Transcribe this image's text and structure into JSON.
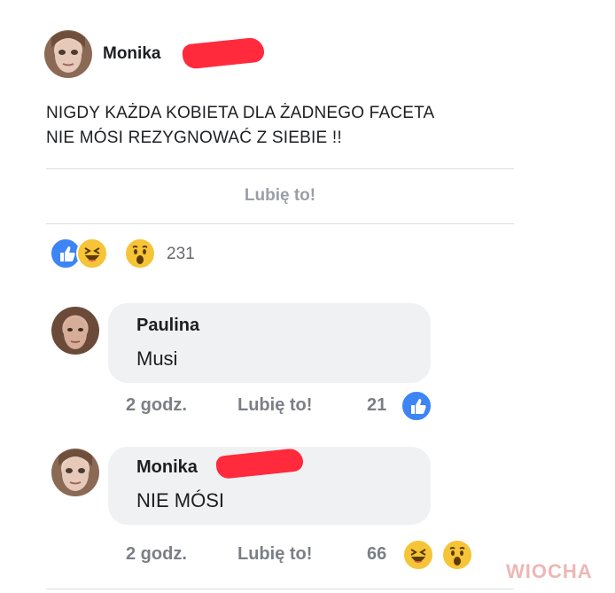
{
  "post": {
    "author": "Monika",
    "text_line1": "NIGDY KAŻDA KOBIETA DLA ŻADNEGO FACETA",
    "text_line2": "NIE MÓSI  REZYGNOWAĆ Z SIEBIE !!",
    "like_button": "Lubię to!",
    "reaction_icons": [
      "like-icon",
      "haha-icon",
      "wow-icon"
    ],
    "reaction_count": "231"
  },
  "comments": [
    {
      "author": "Paulina",
      "text": "Musi",
      "time": "2 godz.",
      "like_label": "Lubię to!",
      "reaction_count": "21",
      "reaction_icons": [
        "like-icon"
      ]
    },
    {
      "author": "Monika",
      "text": "NIE MÓSI",
      "time": "2 godz.",
      "like_label": "Lubię to!",
      "reaction_count": "66",
      "reaction_icons": [
        "haha-icon",
        "wow-icon"
      ]
    }
  ],
  "watermark": "WIOCHA",
  "colors": {
    "like_blue": "#3d84f5",
    "emoji_yellow": "#f6c437",
    "redaction_red": "#ff2a3c",
    "bubble_gray": "#eff1f3"
  }
}
